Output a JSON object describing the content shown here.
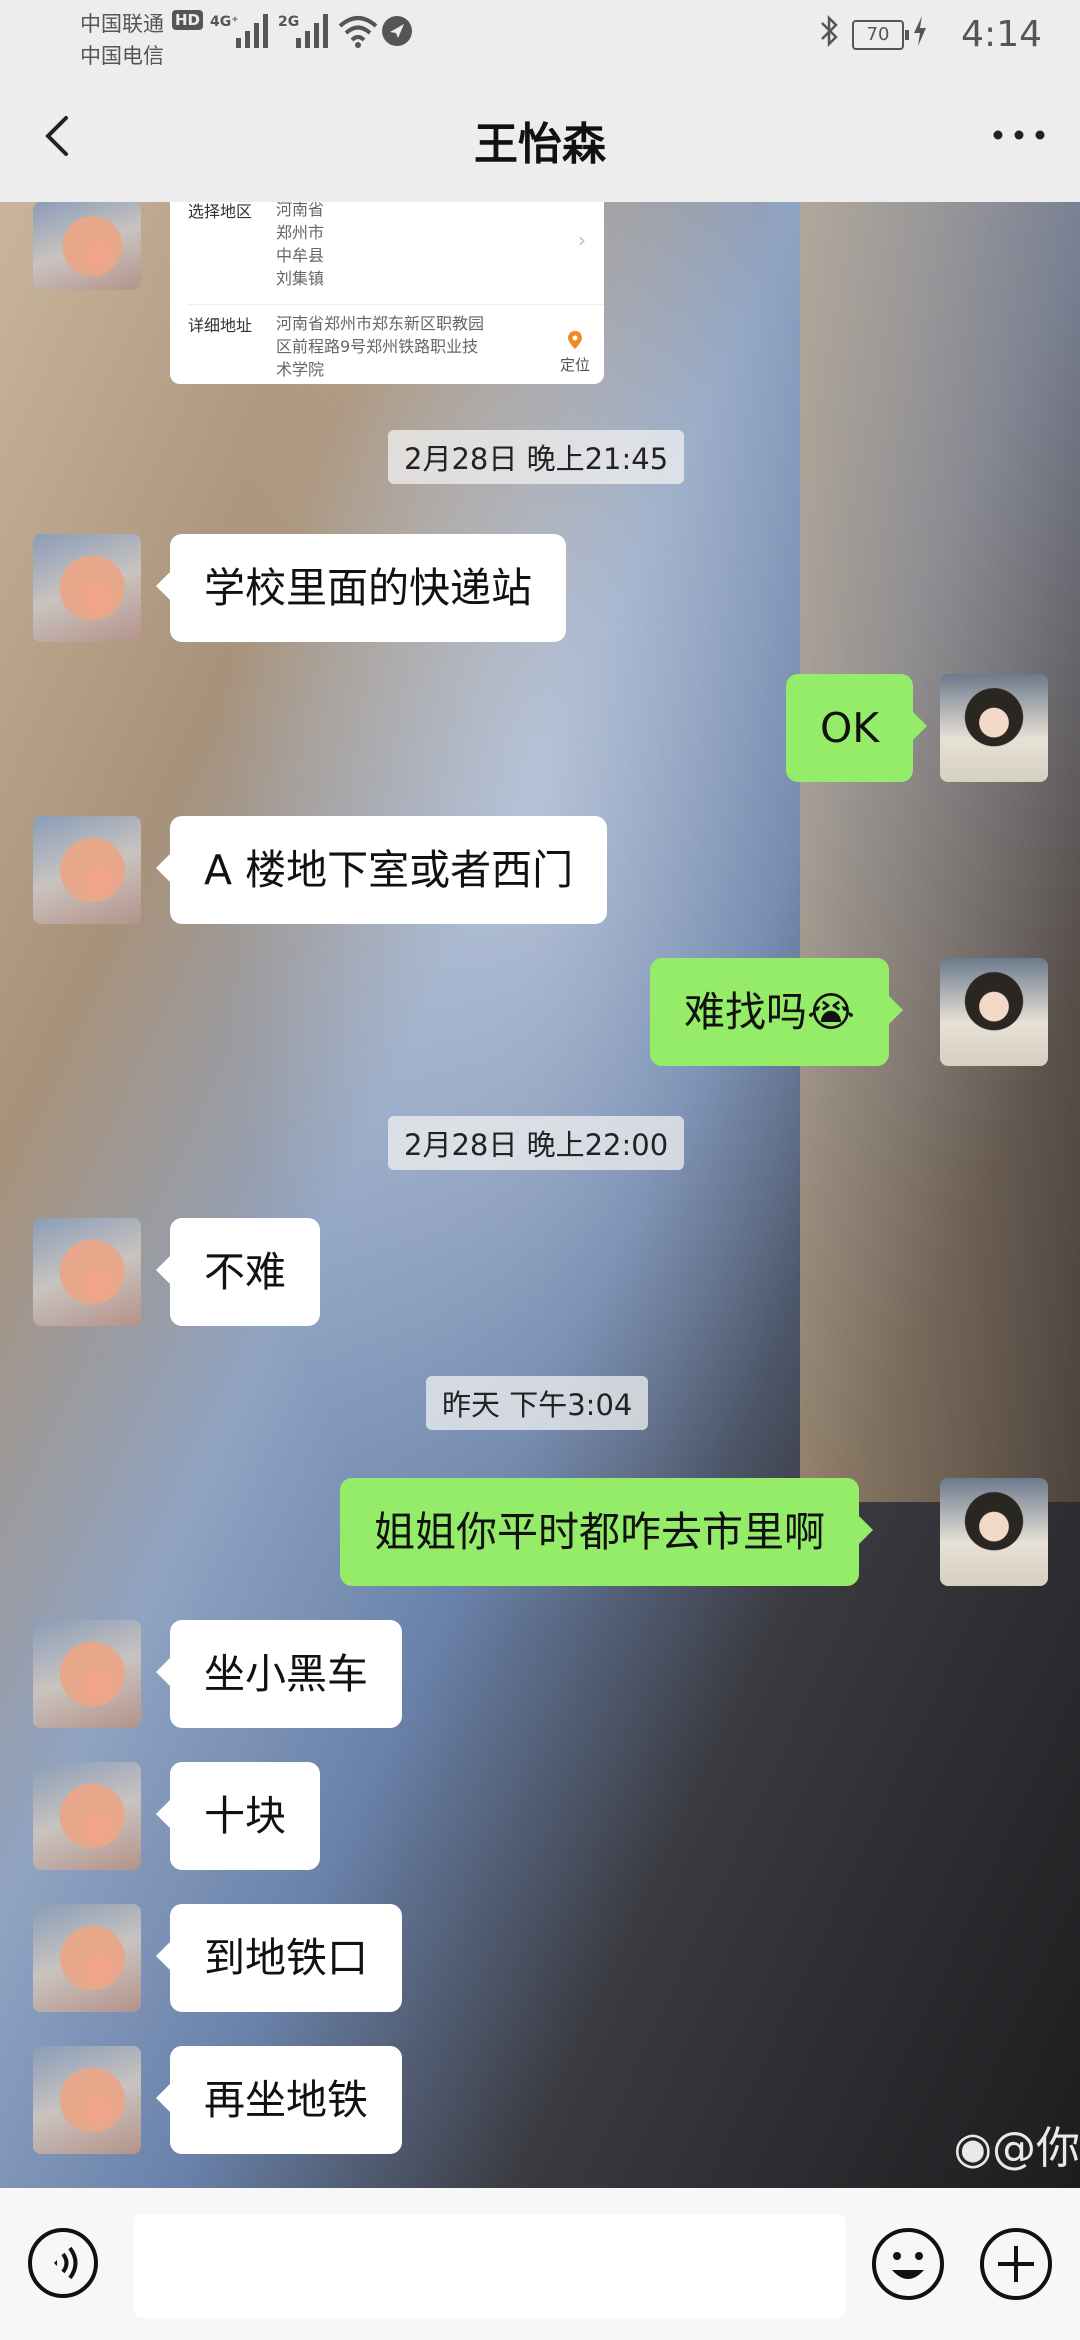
{
  "status_bar": {
    "carrier1": "中国联通",
    "carrier2": "中国电信",
    "hd_badge": "HD",
    "network1": "4G⁺",
    "network2": "2G",
    "battery": "70",
    "time": "4:14"
  },
  "title_bar": {
    "title": "王怡森"
  },
  "address_card": {
    "region_label": "选择地区",
    "region_lines": [
      "河南省",
      "郑州市",
      "中牟县",
      "刘集镇"
    ],
    "detail_label": "详细地址",
    "detail_lines": [
      "河南省郑州市郑东新区职教园",
      "区前程路9号郑州铁路职业技",
      "术学院"
    ],
    "locate_label": "定位"
  },
  "messages": [
    {
      "type": "timestamp",
      "text": "2月28日 晚上21:45"
    },
    {
      "type": "left",
      "text": "学校里面的快递站"
    },
    {
      "type": "right",
      "text": "OK"
    },
    {
      "type": "left",
      "text": "A 楼地下室或者西门"
    },
    {
      "type": "right",
      "text": "难找吗😭"
    },
    {
      "type": "timestamp",
      "text": "2月28日 晚上22:00"
    },
    {
      "type": "left",
      "text": "不难"
    },
    {
      "type": "timestamp",
      "text": "昨天 下午3:04"
    },
    {
      "type": "right",
      "text": "姐姐你平时都咋去市里啊"
    },
    {
      "type": "left",
      "text": "坐小黑车"
    },
    {
      "type": "left",
      "text": "十块"
    },
    {
      "type": "left",
      "text": "到地铁口"
    },
    {
      "type": "left",
      "text": "再坐地铁"
    }
  ],
  "watermark": "@你",
  "icons": {
    "back": "back-arrow-icon",
    "more": "more-dots-icon",
    "voice": "voice-icon",
    "emoji": "emoji-icon",
    "plus": "plus-icon"
  },
  "colors": {
    "right_bubble": "#95ec69",
    "left_bubble": "#ffffff",
    "bar": "#ededed"
  }
}
